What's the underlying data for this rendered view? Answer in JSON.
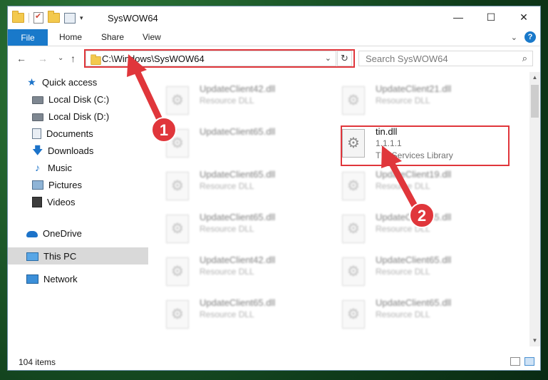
{
  "window": {
    "title": "SysWOW64"
  },
  "titlebar": {
    "minimize": "—",
    "maximize": "☐",
    "close": "✕"
  },
  "ribbon": {
    "tabs": [
      "File",
      "Home",
      "Share",
      "View"
    ],
    "collapse": "⌄",
    "help": "?"
  },
  "nav": {
    "back": "←",
    "forward": "→",
    "recent": "⌄",
    "up": "↑",
    "address": "C:\\Windows\\SysWOW64",
    "address_dropdown": "⌄",
    "refresh": "↻",
    "search_placeholder": "Search SysWOW64",
    "search_icon": "⌕"
  },
  "sidebar": {
    "items": [
      {
        "label": "Quick access",
        "icon": "star-icon",
        "pinned": false
      },
      {
        "label": "Local Disk (C:)",
        "icon": "disk-icon",
        "pinned": true
      },
      {
        "label": "Local Disk (D:)",
        "icon": "disk-icon",
        "pinned": true
      },
      {
        "label": "Documents",
        "icon": "documents-icon",
        "pinned": true
      },
      {
        "label": "Downloads",
        "icon": "download-icon",
        "pinned": true
      },
      {
        "label": "Music",
        "icon": "music-icon",
        "pinned": true
      },
      {
        "label": "Pictures",
        "icon": "pictures-icon",
        "pinned": true
      },
      {
        "label": "Videos",
        "icon": "videos-icon",
        "pinned": true
      },
      {
        "label": "OneDrive",
        "icon": "cloud-icon",
        "pinned": false
      },
      {
        "label": "This PC",
        "icon": "pc-icon",
        "pinned": false,
        "selected": true
      },
      {
        "label": "Network",
        "icon": "network-icon",
        "pinned": false
      }
    ],
    "pin_glyph": "📌"
  },
  "files": [
    {
      "name": "UpdateClient42.dll",
      "type": "Resource DLL"
    },
    {
      "name": "UpdateClient21.dll",
      "type": "Resource DLL"
    },
    {
      "name": "UpdateClient65.dll",
      "type": "Resource DLL"
    },
    {
      "name": "tin.dll",
      "version": "1.1.1.1",
      "description": "TIN Services Library",
      "highlighted": true
    },
    {
      "name": "UpdateClient65.dll",
      "type": "Resource DLL"
    },
    {
      "name": "UpdateClient19.dll",
      "type": "Resource DLL"
    },
    {
      "name": "UpdateClient65.dll",
      "type": "Resource DLL"
    },
    {
      "name": "UpdateClient65.dll",
      "type": "Resource DLL"
    },
    {
      "name": "UpdateClient42.dll",
      "type": "Resource DLL"
    },
    {
      "name": "UpdateClient65.dll",
      "type": "Resource DLL"
    },
    {
      "name": "UpdateClient65.dll",
      "type": "Resource DLL"
    },
    {
      "name": "UpdateClient65.dll",
      "type": "Resource DLL"
    }
  ],
  "status": {
    "count": "104 items"
  },
  "annotations": {
    "badge1": "1",
    "badge2": "2",
    "color": "#e0363b"
  }
}
